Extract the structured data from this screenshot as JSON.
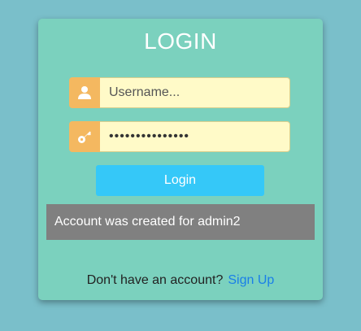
{
  "login": {
    "title": "LOGIN",
    "username": {
      "placeholder": "Username...",
      "value": "",
      "icon": "user-icon"
    },
    "password": {
      "value": "•••••••••••••••",
      "icon": "key-icon"
    },
    "submit_label": "Login",
    "message": "Account was created for admin2",
    "footer": {
      "prompt": "Don't have an account?",
      "link_label": "Sign Up"
    }
  },
  "colors": {
    "background": "#7abfca",
    "card": "#7bd1be",
    "icon_box": "#f4b860",
    "input_bg": "#fffac8",
    "button": "#35c8f8",
    "message_bg": "#808080",
    "link": "#1a7fe8"
  }
}
